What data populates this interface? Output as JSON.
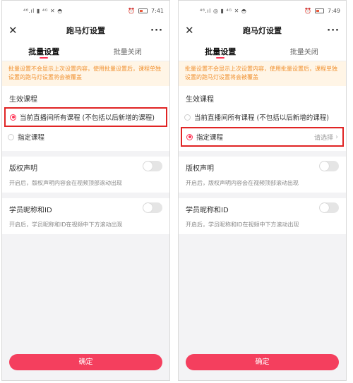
{
  "screens": [
    {
      "status": {
        "left_icons": "⁴⁶.ıl ▮ ⁴ᴳ ✕ ◓",
        "time": "7:41"
      },
      "nav": {
        "close": "✕",
        "title": "跑马灯设置",
        "more": "···"
      },
      "tabs": [
        {
          "label": "批量设置",
          "active": true
        },
        {
          "label": "批量关闭",
          "active": false
        }
      ],
      "notice": "批量设置不会显示上次设置内容，使用批量设置后，课程单独设置的跑马灯设置将会被覆盖",
      "scope": {
        "title": "生效课程",
        "options": [
          {
            "label": "当前直播间所有课程 (不包括以后新增的课程)",
            "selected": true,
            "highlighted": true
          },
          {
            "label": "指定课程",
            "selected": false,
            "highlighted": false,
            "pick_text": ""
          }
        ]
      },
      "settings": [
        {
          "title": "版权声明",
          "desc": "开启后，版权声明内容会在视频顶部滚动出现",
          "enabled": false
        },
        {
          "title": "学员昵称和ID",
          "desc": "开启后，学员昵称和ID在视频中下方滚动出现",
          "enabled": false
        }
      ],
      "confirm": "确定"
    },
    {
      "status": {
        "left_icons": "⁴⁶.ıl ◎ ▮ ⁴ᴳ ✕ ◓",
        "time": "7:49"
      },
      "nav": {
        "close": "✕",
        "title": "跑马灯设置",
        "more": "···"
      },
      "tabs": [
        {
          "label": "批量设置",
          "active": true
        },
        {
          "label": "批量关闭",
          "active": false
        }
      ],
      "notice": "批量设置不会显示上次设置内容，使用批量设置后，课程单独设置的跑马灯设置将会被覆盖",
      "scope": {
        "title": "生效课程",
        "options": [
          {
            "label": "当前直播间所有课程 (不包括以后新增的课程)",
            "selected": false,
            "highlighted": false
          },
          {
            "label": "指定课程",
            "selected": true,
            "highlighted": true,
            "pick_text": "请选择"
          }
        ]
      },
      "settings": [
        {
          "title": "版权声明",
          "desc": "开启后，版权声明内容会在视频顶部滚动出现",
          "enabled": false
        },
        {
          "title": "学员昵称和ID",
          "desc": "开启后，学员昵称和ID在视频中下方滚动出现",
          "enabled": false
        }
      ],
      "confirm": "确定"
    }
  ],
  "colors": {
    "accent": "#ff3355",
    "notice_text": "#f0902e",
    "notice_bg": "#fff5e6",
    "highlight_box": "#e02424"
  }
}
